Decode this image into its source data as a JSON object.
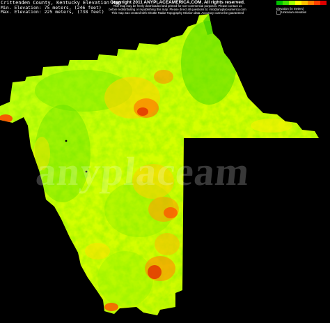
{
  "map": {
    "title": "Crittenden County, Kentucky Elevation Map",
    "min_elevation": "Min. Elevation: 75 meters, (246 feet)",
    "max_elevation": "Max. Elevation: 225 meters, (738 feet)",
    "watermark": "anyplaceam"
  },
  "credit": {
    "line1": "Copyright 2011 ANYPLACEAMERICA.COM.  All rights reserved.",
    "line2": "This map may be freely downloaded and printed for non-commercial purposes.  Please contact us",
    "line3": "before redistributing or republishing this map.  Please direct all questions to: info@anyplaceamerica.com",
    "line4": "This map was created with Shuttle Radar Topography Mission data.  Accuracy cannot be guaranteed"
  },
  "legend": {
    "scale_label": "Elevation (in meters)",
    "unknown_label": "Unknown elevation",
    "colors": [
      "#00c000",
      "#40e000",
      "#a0ff00",
      "#ffff00",
      "#ffc000",
      "#ff8000",
      "#ff4000",
      "#e00000"
    ]
  },
  "colors": {
    "background": "#000000",
    "low": "#6fe000",
    "mid": "#ccff00",
    "high": "#e04000"
  }
}
